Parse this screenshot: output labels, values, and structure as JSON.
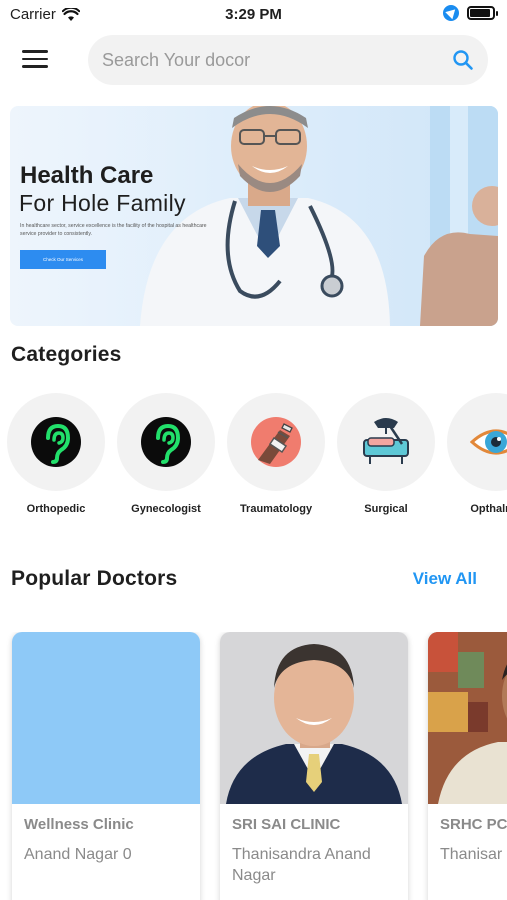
{
  "status_bar": {
    "carrier": "Carrier",
    "time": "3:29 PM"
  },
  "header": {
    "search_placeholder": "Search Your docor",
    "accent_color": "#2196f3"
  },
  "banner": {
    "title": "Health Care",
    "subtitle": "For Hole Family",
    "description": "In healthcare sector, service excellence is the facility of the hospital as healthcare service provider to consistently.",
    "button_label": "Check Our Services"
  },
  "categories": {
    "title": "Categories",
    "items": [
      {
        "label": "Orthopedic",
        "icon": "ear-icon"
      },
      {
        "label": "Gynecologist",
        "icon": "ear-icon"
      },
      {
        "label": "Traumatology",
        "icon": "bandaged-arm-icon"
      },
      {
        "label": "Surgical",
        "icon": "surgery-icon"
      },
      {
        "label": "Opthalmo",
        "icon": "eye-icon"
      }
    ]
  },
  "popular_doctors": {
    "title": "Popular Doctors",
    "view_all_label": "View All",
    "items": [
      {
        "name": "Wellness Clinic",
        "address": "Anand Nagar 0"
      },
      {
        "name": "SRI SAI CLINIC",
        "address": "Thanisandra Anand Nagar"
      },
      {
        "name": "SRHC PC",
        "address": "Thanisar"
      }
    ]
  }
}
